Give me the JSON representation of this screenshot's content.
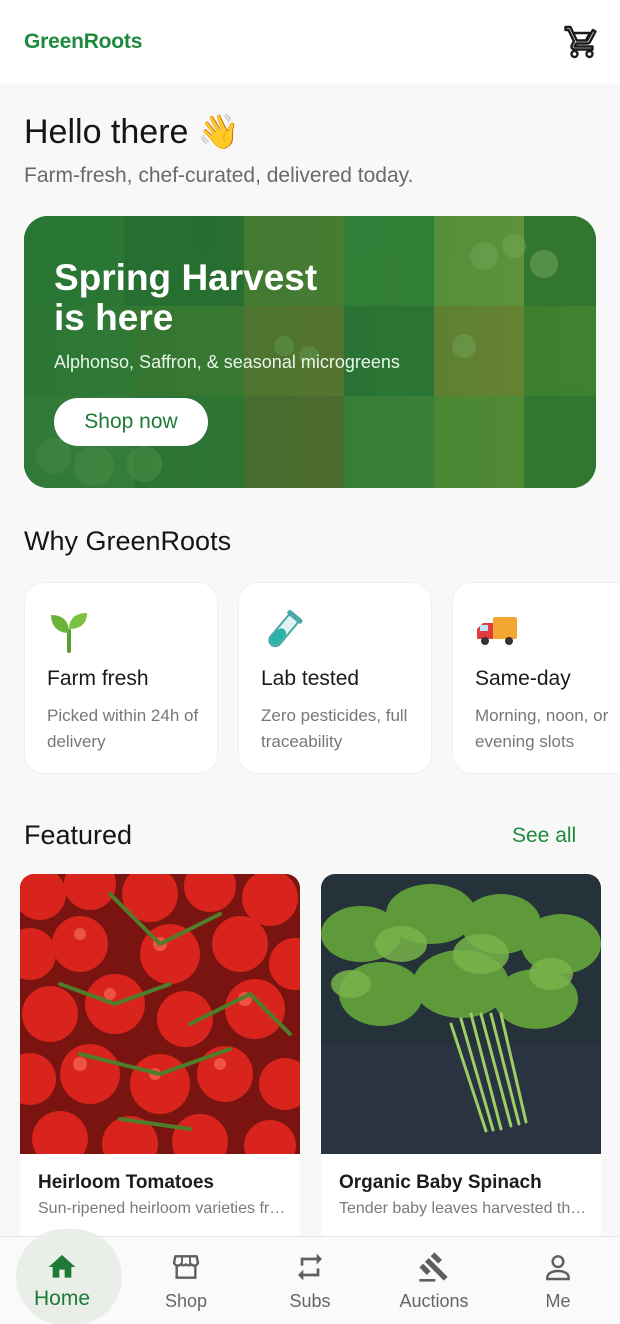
{
  "header": {
    "brand": "GreenRoots",
    "cart_icon": "cart-icon"
  },
  "greeting": {
    "title": "Hello there 👋",
    "subtitle": "Farm-fresh, chef-curated, delivered today."
  },
  "hero": {
    "title_line1": "Spring Harvest",
    "title_line2": "is here",
    "subtitle": "Alphonso, Saffron, & seasonal microgreens",
    "button": "Shop now"
  },
  "why": {
    "title": "Why GreenRoots",
    "items": [
      {
        "icon": "seedling-icon",
        "name": "Farm fresh",
        "desc": "Picked within 24h of delivery"
      },
      {
        "icon": "test-tube-icon",
        "name": "Lab tested",
        "desc": "Zero pesticides, full traceability"
      },
      {
        "icon": "delivery-truck-icon",
        "name": "Same-day",
        "desc": "Morning, noon, or evening slots"
      }
    ]
  },
  "featured": {
    "title": "Featured",
    "see_all": "See all",
    "products": [
      {
        "name": "Heirloom Tomatoes",
        "desc": "Sun-ripened heirloom varieties from local farms"
      },
      {
        "name": "Organic Baby Spinach",
        "desc": "Tender baby leaves harvested this morning"
      }
    ]
  },
  "nav": {
    "items": [
      {
        "label": "Home",
        "icon": "home-icon",
        "active": true
      },
      {
        "label": "Shop",
        "icon": "storefront-icon",
        "active": false
      },
      {
        "label": "Subs",
        "icon": "repeat-icon",
        "active": false
      },
      {
        "label": "Auctions",
        "icon": "gavel-icon",
        "active": false
      },
      {
        "label": "Me",
        "icon": "person-icon",
        "active": false
      }
    ]
  },
  "colors": {
    "brand": "#1e8a3c",
    "hero_green": "#226e34",
    "background": "#f8f8f8"
  }
}
